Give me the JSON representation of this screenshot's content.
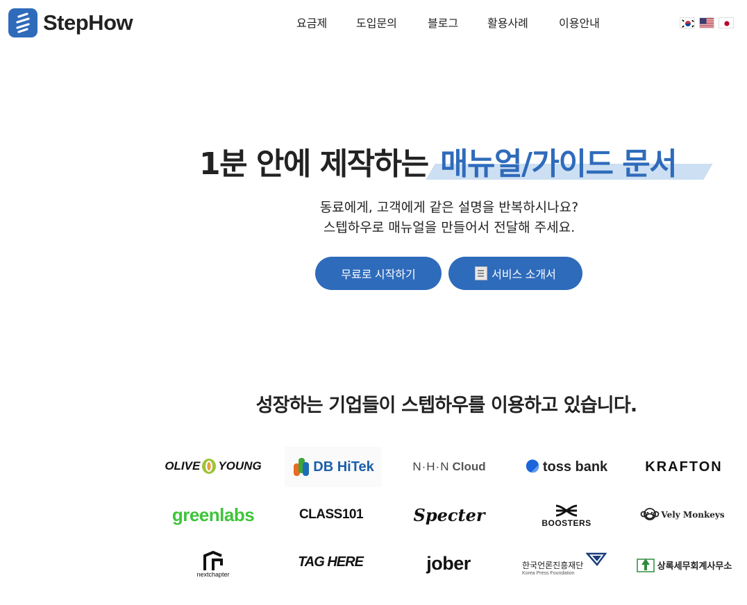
{
  "header": {
    "brand_name": "StepHow",
    "nav": [
      "요금제",
      "도입문의",
      "블로그",
      "활용사례",
      "이용안내"
    ],
    "languages": [
      {
        "icon": "korea-flag-icon"
      },
      {
        "icon": "usa-flag-icon"
      },
      {
        "icon": "japan-flag-icon"
      }
    ]
  },
  "hero": {
    "title_dark": "1분 안에 제작하는",
    "title_blue": "매뉴얼/가이드 문서",
    "subtitle_line1": "동료에게, 고객에게 같은 설명을 반복하시나요?",
    "subtitle_line2": "스텝하우로 매뉴얼을 만들어서 전달해 주세요.",
    "primary_button": "무료로 시작하기",
    "secondary_button": "서비스 소개서"
  },
  "customers": {
    "title": "성장하는 기업들이 스텝하우를 이용하고 있습니다.",
    "logos": {
      "oliveyoung_a": "OLIVE",
      "oliveyoung_b": "YOUNG",
      "dbhitek": "DB HiTek",
      "nhncloud_a": "N·H·N",
      "nhncloud_b": "Cloud",
      "tossbank": "toss bank",
      "krafton": "KRAFTON",
      "greenlabs": "greenlabs",
      "class101": "CLASS101",
      "specter": "Specter",
      "boosters": "BOOSTERS",
      "velymonkeys": "Vely Monkeys",
      "nextchapter": "nextchapter",
      "taghere": "TAG HERE",
      "jober": "jober",
      "kpf_ko": "한국언론진흥재단",
      "kpf_en": "Korea Press Foundation",
      "sangrok": "상록세무회계사무소"
    }
  },
  "colors": {
    "brand_blue": "#2f6bbb",
    "highlight": "#cddff2",
    "text": "#222222"
  }
}
